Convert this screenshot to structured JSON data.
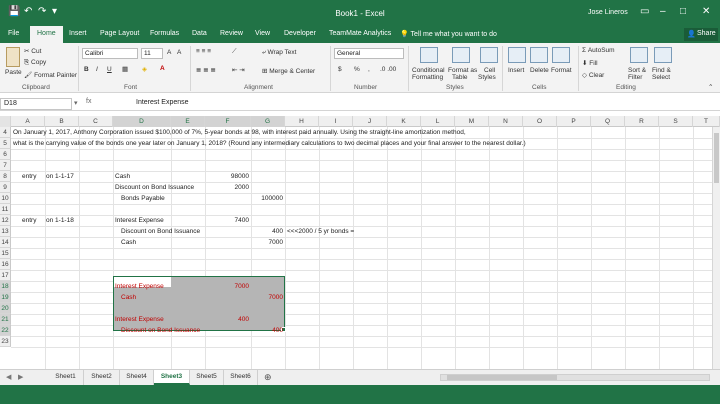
{
  "titlebar": {
    "title": "Book1 - Excel",
    "user": "Jose Lineros",
    "qa": {
      "save": "💾",
      "undo": "↶",
      "redo": "↷",
      "more": "▾"
    },
    "win": {
      "opts": "▭",
      "min": "–",
      "max": "□",
      "close": "✕"
    }
  },
  "tabs": {
    "items": [
      "File",
      "Home",
      "Insert",
      "Page Layout",
      "Formulas",
      "Data",
      "Review",
      "View",
      "Developer",
      "TeamMate Analytics"
    ],
    "tell_me": "Tell me what you want to do",
    "share": "Share"
  },
  "ribbon": {
    "clipboard": {
      "paste": "Paste",
      "cut": "Cut",
      "copy": "Copy",
      "format_painter": "Format Painter",
      "label": "Clipboard"
    },
    "font": {
      "name": "Calibri",
      "size": "11",
      "label": "Font",
      "bold": "B",
      "italic": "I",
      "underline": "U"
    },
    "alignment": {
      "wrap": "Wrap Text",
      "merge": "Merge & Center",
      "label": "Alignment"
    },
    "number": {
      "format": "General",
      "label": "Number",
      "currency": "$",
      "percent": "%",
      "comma": ","
    },
    "styles": {
      "cond": "Conditional",
      "cond2": "Formatting",
      "table": "Format as",
      "table2": "Table",
      "cell": "Cell",
      "cell2": "Styles",
      "label": "Styles"
    },
    "cells": {
      "insert": "Insert",
      "delete": "Delete",
      "format": "Format",
      "label": "Cells"
    },
    "editing": {
      "autosum": "AutoSum",
      "fill": "Fill",
      "clear": "Clear",
      "sort": "Sort &",
      "sort2": "Filter",
      "find": "Find &",
      "find2": "Select",
      "label": "Editing"
    }
  },
  "formula_bar": {
    "name_box": "D18",
    "fx": "fx",
    "value": "Interest Expense"
  },
  "columns": [
    "A",
    "B",
    "C",
    "D",
    "E",
    "F",
    "G",
    "H",
    "I",
    "J",
    "K",
    "L",
    "M",
    "N",
    "O",
    "P",
    "Q",
    "R",
    "S",
    "T"
  ],
  "rows": [
    "4",
    "5",
    "6",
    "7",
    "8",
    "9",
    "10",
    "11",
    "12",
    "13",
    "14",
    "15",
    "16",
    "17",
    "18",
    "19",
    "20",
    "21",
    "22",
    "23"
  ],
  "cells": {
    "a4": "On January 1, 2017, Anthony Corporation issued $100,000 of 7%, 5-year bonds at 98, with interest paid annually. Using the straight-line amortization method,",
    "a5": "what is the carrying value of the bonds one year later on January 1, 2018? (Round any intermediary calculations to two decimal places and your final answer to the nearest dollar.)",
    "a8": "entry",
    "b8": "on 1-1-17",
    "d8": "Cash",
    "f8": "98000",
    "d9": "Discount on Bond Issuance",
    "f9": "2000",
    "d10": "Bonds Payable",
    "g10": "100000",
    "a12": "entry",
    "b12": "on 1-1-18",
    "d12": "Interest Expense",
    "f12": "7400",
    "d13": "Discount on Bond Issuance",
    "g13": "400",
    "h13": "<<<2000 / 5 yr bonds =",
    "d14": "Cash",
    "g14": "7000",
    "d18": "Interest Expense",
    "f18": "7000",
    "d19": "Cash",
    "g19": "7000",
    "d21": "Interest Expense",
    "f21": "400",
    "d22": "Discount on Bond Issuance",
    "g22": "400"
  },
  "sheets": [
    "Sheet1",
    "Sheet2",
    "Sheet4",
    "Sheet3",
    "Sheet5",
    "Sheet6"
  ],
  "active_sheet": "Sheet3",
  "colors": {
    "excel_green": "#217346",
    "red_text": "#c00000",
    "selection_gray": "#b5b5b5"
  }
}
